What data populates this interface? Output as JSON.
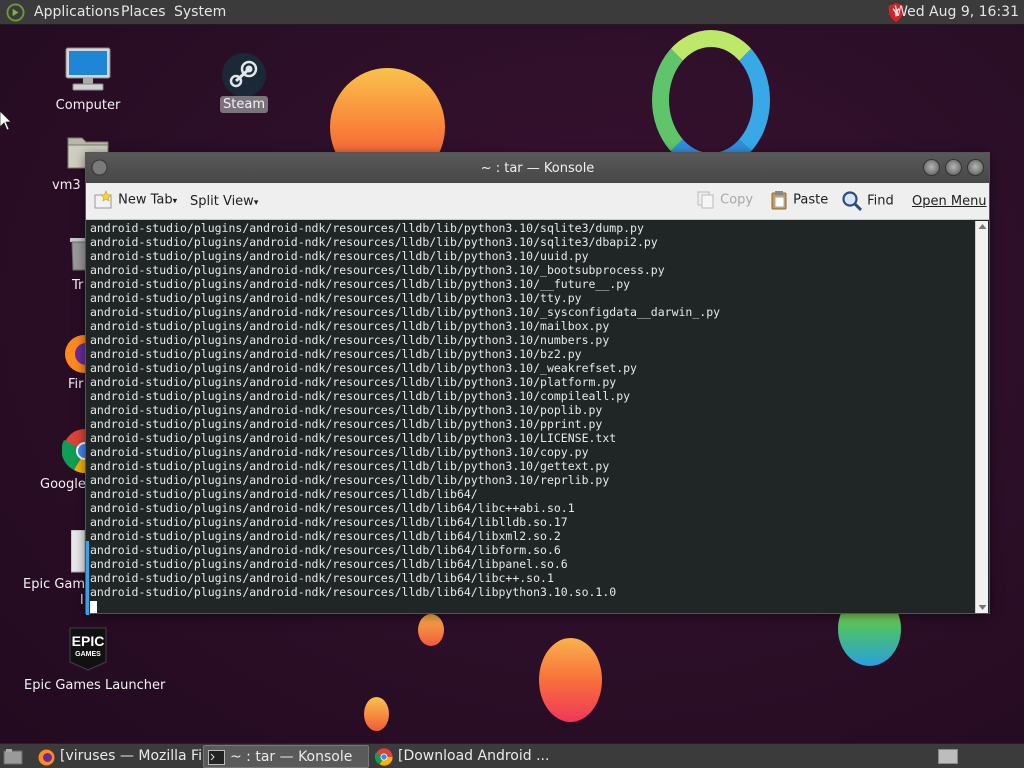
{
  "top_panel": {
    "menus": [
      "Applications",
      "Places",
      "System"
    ],
    "clock": "Wed Aug  9, 16:31"
  },
  "desktop": {
    "icons": [
      {
        "name": "computer",
        "label": "Computer"
      },
      {
        "name": "steam",
        "label": "Steam"
      },
      {
        "name": "vm3",
        "label": "vm3"
      },
      {
        "name": "trash",
        "label": "Tr"
      },
      {
        "name": "firefox",
        "label": "Fir"
      },
      {
        "name": "chrome",
        "label": "Google"
      },
      {
        "name": "epic-games-file",
        "label": "Epic Game",
        "label2": "l"
      },
      {
        "name": "epic-games-launcher",
        "label": "Epic Games Launcher",
        "logo_text": "EPIC",
        "logo_sub": "GAMES"
      }
    ]
  },
  "konsole": {
    "title": "~ : tar — Konsole",
    "toolbar": {
      "new_tab": "New Tab",
      "split_view": "Split View",
      "copy": "Copy",
      "paste": "Paste",
      "find": "Find",
      "open_menu": "Open Menu"
    },
    "lines": [
      "android-studio/plugins/android-ndk/resources/lldb/lib/python3.10/sqlite3/dump.py",
      "android-studio/plugins/android-ndk/resources/lldb/lib/python3.10/sqlite3/dbapi2.py",
      "android-studio/plugins/android-ndk/resources/lldb/lib/python3.10/uuid.py",
      "android-studio/plugins/android-ndk/resources/lldb/lib/python3.10/_bootsubprocess.py",
      "android-studio/plugins/android-ndk/resources/lldb/lib/python3.10/__future__.py",
      "android-studio/plugins/android-ndk/resources/lldb/lib/python3.10/tty.py",
      "android-studio/plugins/android-ndk/resources/lldb/lib/python3.10/_sysconfigdata__darwin_.py",
      "android-studio/plugins/android-ndk/resources/lldb/lib/python3.10/mailbox.py",
      "android-studio/plugins/android-ndk/resources/lldb/lib/python3.10/numbers.py",
      "android-studio/plugins/android-ndk/resources/lldb/lib/python3.10/bz2.py",
      "android-studio/plugins/android-ndk/resources/lldb/lib/python3.10/_weakrefset.py",
      "android-studio/plugins/android-ndk/resources/lldb/lib/python3.10/platform.py",
      "android-studio/plugins/android-ndk/resources/lldb/lib/python3.10/compileall.py",
      "android-studio/plugins/android-ndk/resources/lldb/lib/python3.10/poplib.py",
      "android-studio/plugins/android-ndk/resources/lldb/lib/python3.10/pprint.py",
      "android-studio/plugins/android-ndk/resources/lldb/lib/python3.10/LICENSE.txt",
      "android-studio/plugins/android-ndk/resources/lldb/lib/python3.10/copy.py",
      "android-studio/plugins/android-ndk/resources/lldb/lib/python3.10/gettext.py",
      "android-studio/plugins/android-ndk/resources/lldb/lib/python3.10/reprlib.py",
      "android-studio/plugins/android-ndk/resources/lldb/lib64/",
      "android-studio/plugins/android-ndk/resources/lldb/lib64/libc++abi.so.1",
      "android-studio/plugins/android-ndk/resources/lldb/lib64/liblldb.so.17",
      "android-studio/plugins/android-ndk/resources/lldb/lib64/libxml2.so.2",
      "android-studio/plugins/android-ndk/resources/lldb/lib64/libform.so.6",
      "android-studio/plugins/android-ndk/resources/lldb/lib64/libpanel.so.6",
      "android-studio/plugins/android-ndk/resources/lldb/lib64/libc++.so.1",
      "android-studio/plugins/android-ndk/resources/lldb/lib64/libpython3.10.so.1.0"
    ]
  },
  "taskbar": {
    "tasks": [
      {
        "label": "[viruses — Mozilla Fi...",
        "icon": "firefox-icon"
      },
      {
        "label": "~ : tar — Konsole",
        "icon": "terminal-icon"
      },
      {
        "label": "[Download Android ...",
        "icon": "chrome-icon"
      }
    ]
  },
  "colors": {
    "panel": "#3b3b3b",
    "terminal_bg": "#202626",
    "terminal_fg": "#e8e8e8",
    "accent": "#3aa0e8"
  }
}
